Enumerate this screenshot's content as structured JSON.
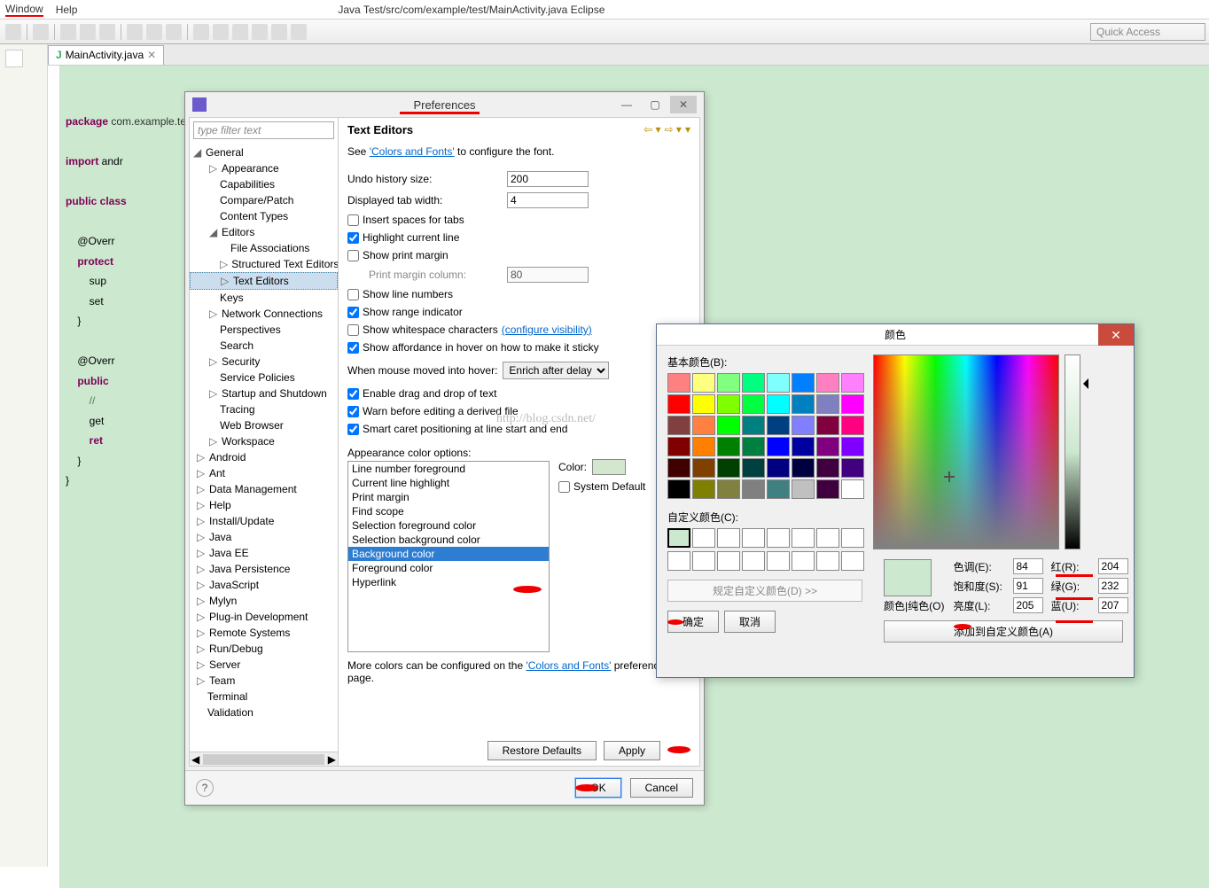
{
  "menu": {
    "window": "Window",
    "help": "Help"
  },
  "titlebar_partial": "Java   Test/src/com/example/test/MainActivity.java   Eclipse",
  "quick_access": "Quick Access",
  "tab": {
    "label": "MainActivity.java"
  },
  "code": {
    "l1a": "package",
    "l1b": " com.example.test;",
    "l2a": "import",
    "l2b": " andr",
    "l3a": "public class",
    "l3b": "",
    "l4": "    @Overr",
    "l5a": "    protect",
    "l6": "        sup",
    "l7": "        set",
    "l8": "    }",
    "l9": "    @Overr",
    "l10a": "    public",
    "l11": "        //",
    "l12": "        get",
    "l13": "        ret",
    "l14": "    }",
    "l15": "}"
  },
  "pref": {
    "title": "Preferences",
    "filter_placeholder": "type filter text",
    "tree": {
      "general": "General",
      "appearance": "Appearance",
      "capabilities": "Capabilities",
      "compare": "Compare/Patch",
      "content_types": "Content Types",
      "editors": "Editors",
      "file_assoc": "File Associations",
      "struct_text": "Structured Text Editors",
      "text_editors": "Text Editors",
      "keys": "Keys",
      "network": "Network Connections",
      "perspectives": "Perspectives",
      "search": "Search",
      "security": "Security",
      "service_pol": "Service Policies",
      "startup": "Startup and Shutdown",
      "tracing": "Tracing",
      "web_browser": "Web Browser",
      "workspace": "Workspace",
      "android": "Android",
      "ant": "Ant",
      "data_mgmt": "Data Management",
      "help": "Help",
      "install": "Install/Update",
      "java": "Java",
      "javaee": "Java EE",
      "javapers": "Java Persistence",
      "javascript": "JavaScript",
      "mylyn": "Mylyn",
      "plugin_dev": "Plug-in Development",
      "remote": "Remote Systems",
      "rundebug": "Run/Debug",
      "server": "Server",
      "team": "Team",
      "terminal": "Terminal",
      "validation": "Validation"
    },
    "page_title": "Text Editors",
    "see": "See ",
    "colors_fonts_link": "'Colors and Fonts'",
    "see2": " to configure the font.",
    "undo_label": "Undo history size:",
    "undo_val": "200",
    "tabw_label": "Displayed tab width:",
    "tabw_val": "4",
    "insert_spaces": "Insert spaces for tabs",
    "highlight_line": "Highlight current line",
    "show_margin": "Show print margin",
    "margin_col_label": "Print margin column:",
    "margin_col_val": "80",
    "show_linenum": "Show line numbers",
    "show_range": "Show range indicator",
    "show_ws": "Show whitespace characters ",
    "conf_vis": "(configure visibility)",
    "show_afford": "Show affordance in hover on how to make it sticky",
    "hover_label": "When mouse moved into hover:",
    "hover_val": "Enrich after delay",
    "enable_dnd": "Enable drag and drop of text",
    "warn_derived": "Warn before editing a derived file",
    "smart_caret": "Smart caret positioning at line start and end",
    "appearance_opts": "Appearance color options:",
    "opts": [
      "Line number foreground",
      "Current line highlight",
      "Print margin",
      "Find scope",
      "Selection foreground color",
      "Selection background color",
      "Background color",
      "Foreground color",
      "Hyperlink"
    ],
    "color_label": "Color:",
    "sys_default": "System Default",
    "more_colors_1": "More colors can be configured on the ",
    "more_colors_link": "'Colors and Fonts'",
    "more_colors_2": " preference page.",
    "restore": "Restore Defaults",
    "apply": "Apply",
    "ok": "OK",
    "cancel": "Cancel"
  },
  "colordlg": {
    "title": "颜色",
    "basic_label": "基本颜色(B):",
    "custom_label": "自定义颜色(C):",
    "define_custom": "规定自定义颜色(D) >>",
    "ok": "确定",
    "cancel": "取消",
    "color_solid": "颜色|纯色(O)",
    "hue": "色调(E):",
    "hue_v": "84",
    "sat": "饱和度(S):",
    "sat_v": "91",
    "lum": "亮度(L):",
    "lum_v": "205",
    "red": "红(R):",
    "red_v": "204",
    "green": "绿(G):",
    "green_v": "232",
    "blue": "蓝(U):",
    "blue_v": "207",
    "add_custom": "添加到自定义颜色(A)",
    "palette": [
      "#ff8080",
      "#ffff80",
      "#80ff80",
      "#00ff80",
      "#80ffff",
      "#0080ff",
      "#ff80c0",
      "#ff80ff",
      "#ff0000",
      "#ffff00",
      "#80ff00",
      "#00ff40",
      "#00ffff",
      "#0080c0",
      "#8080c0",
      "#ff00ff",
      "#804040",
      "#ff8040",
      "#00ff00",
      "#008080",
      "#004080",
      "#8080ff",
      "#800040",
      "#ff0080",
      "#800000",
      "#ff8000",
      "#008000",
      "#008040",
      "#0000ff",
      "#0000a0",
      "#800080",
      "#8000ff",
      "#400000",
      "#804000",
      "#004000",
      "#004040",
      "#000080",
      "#000040",
      "#400040",
      "#400080",
      "#000000",
      "#808000",
      "#808040",
      "#808080",
      "#408080",
      "#c0c0c0",
      "#400040",
      "#ffffff"
    ]
  },
  "watermark": "http://blog.csdn.net/"
}
